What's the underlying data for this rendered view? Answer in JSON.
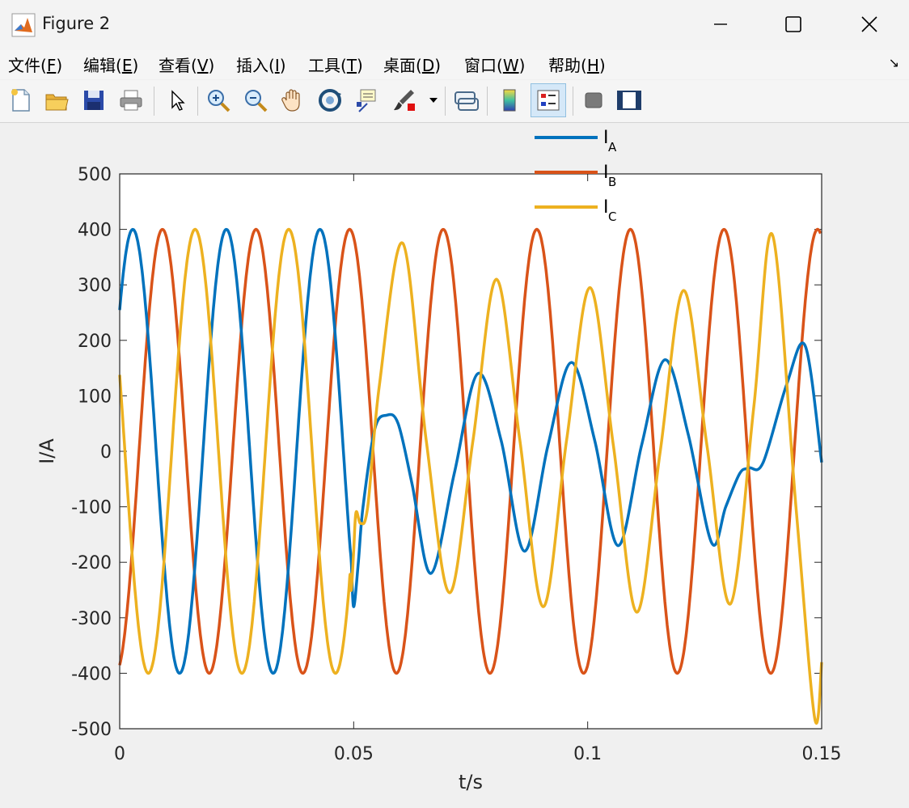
{
  "window": {
    "title": "Figure 2"
  },
  "menu": {
    "items": [
      {
        "label": "文件(",
        "key": "F",
        "tail": ")"
      },
      {
        "label": "编辑(",
        "key": "E",
        "tail": ")"
      },
      {
        "label": "查看(",
        "key": "V",
        "tail": ")"
      },
      {
        "label": "插入(",
        "key": "I",
        "tail": ")"
      },
      {
        "label": "工具(",
        "key": "T",
        "tail": ")"
      },
      {
        "label": "桌面(",
        "key": "D",
        "tail": ")"
      },
      {
        "label": "窗口(",
        "key": "W",
        "tail": ")"
      },
      {
        "label": "帮助(",
        "key": "H",
        "tail": ")"
      }
    ]
  },
  "toolbar": {
    "icons": [
      "new-figure-icon",
      "open-file-icon",
      "save-icon",
      "print-icon",
      "select-arrow-icon",
      "zoom-in-icon",
      "zoom-out-icon",
      "pan-hand-icon",
      "rotate-3d-icon",
      "data-cursor-icon",
      "brush-icon",
      "link-plot-icon",
      "colorbar-icon",
      "legend-icon",
      "hide-plot-tools-icon",
      "show-plot-tools-icon"
    ]
  },
  "chart_data": {
    "type": "line",
    "xlabel": "t/s",
    "ylabel": "I/A",
    "xlim": [
      0,
      0.15
    ],
    "ylim": [
      -500,
      500
    ],
    "xticks": [
      "0",
      "0.05",
      "0.1",
      "0.15"
    ],
    "xtick_values": [
      0,
      0.05,
      0.1,
      0.15
    ],
    "yticks": [
      "500",
      "400",
      "300",
      "200",
      "100",
      "0",
      "-100",
      "-200",
      "-300",
      "-400",
      "-500"
    ],
    "ytick_values": [
      500,
      400,
      300,
      200,
      100,
      0,
      -100,
      -200,
      -300,
      -400,
      -500
    ],
    "legend_position": "top-right, above axes",
    "series": [
      {
        "name": "I",
        "sub": "A",
        "color": "#0072bd",
        "x": [
          0,
          0.0025,
          0.0075,
          0.0125,
          0.0175,
          0.0225,
          0.0275,
          0.0325,
          0.0375,
          0.0425,
          0.0475,
          0.0495,
          0.05,
          0.051,
          0.052,
          0.0545,
          0.057,
          0.0595,
          0.0625,
          0.0665,
          0.0715,
          0.0765,
          0.0815,
          0.0865,
          0.0915,
          0.0965,
          0.1015,
          0.1065,
          0.1115,
          0.1165,
          0.1215,
          0.1265,
          0.1295,
          0.1325,
          0.1345,
          0.1375,
          0.1425,
          0.1465,
          0.15
        ],
        "y": [
          255,
          400,
          0,
          -400,
          0,
          400,
          0,
          -400,
          0,
          400,
          0,
          -200,
          -280,
          -200,
          -100,
          40,
          65,
          50,
          -60,
          -220,
          -40,
          140,
          20,
          -180,
          10,
          160,
          20,
          -170,
          10,
          165,
          30,
          -165,
          -100,
          -40,
          -30,
          -20,
          120,
          190,
          -20
        ]
      },
      {
        "name": "I",
        "sub": "B",
        "color": "#d95319",
        "x": [
          0,
          0.0017,
          0.0042,
          0.0067,
          0.0092,
          0.0117,
          0.0142,
          0.0167,
          0.0192,
          0.0217,
          0.0242,
          0.0267,
          0.0292,
          0.0317,
          0.0342,
          0.0367,
          0.0392,
          0.0417,
          0.0442,
          0.0467,
          0.0492,
          0.0517,
          0.0542,
          0.0567,
          0.0592,
          0.0617,
          0.0642,
          0.0667,
          0.0692,
          0.0717,
          0.0742,
          0.0767,
          0.0792,
          0.0817,
          0.0842,
          0.0867,
          0.0892,
          0.0917,
          0.0942,
          0.0967,
          0.0992,
          0.1017,
          0.1042,
          0.1067,
          0.1092,
          0.1117,
          0.1142,
          0.1167,
          0.1192,
          0.1217,
          0.1242,
          0.1267,
          0.1292,
          0.1317,
          0.1342,
          0.1367,
          0.1392,
          0.1417,
          0.1442,
          0.1467,
          0.1492,
          0.15
        ],
        "y": [
          -400,
          -380,
          0,
          380,
          0,
          0,
          0,
          -400,
          -400,
          0,
          400,
          0,
          -400,
          0,
          400,
          0,
          -400,
          0,
          400,
          0,
          -400,
          0,
          400,
          0,
          -400,
          0,
          400,
          0,
          -400,
          0,
          400,
          0,
          -400,
          0,
          400,
          0,
          -400,
          0,
          400,
          0,
          -400,
          0,
          400,
          0,
          -400,
          0,
          400,
          0,
          -400,
          0,
          400,
          0,
          -400,
          0,
          400,
          0,
          -400,
          0,
          400,
          0,
          400,
          400
        ],
        "period": 0.02,
        "amplitude": 400,
        "phase_note": "sinusoid"
      },
      {
        "name": "I",
        "sub": "C",
        "color": "#edb120",
        "x": [
          0,
          0.0065,
          0.0165,
          0.0265,
          0.0365,
          0.0465,
          0.0495,
          0.05,
          0.0505,
          0.0515,
          0.053,
          0.0555,
          0.0605,
          0.0655,
          0.0705,
          0.0755,
          0.0805,
          0.0855,
          0.0905,
          0.0955,
          0.1005,
          0.1055,
          0.1105,
          0.1155,
          0.1205,
          0.1255,
          0.1305,
          0.1355,
          0.1395,
          0.1445,
          0.1485,
          0.15
        ],
        "y": [
          140,
          -400,
          400,
          -400,
          400,
          -400,
          -250,
          -180,
          -110,
          -130,
          -100,
          120,
          375,
          20,
          -255,
          20,
          310,
          20,
          -280,
          20,
          295,
          10,
          -290,
          0,
          290,
          10,
          -275,
          80,
          390,
          -100,
          -480,
          -380
        ]
      }
    ]
  }
}
